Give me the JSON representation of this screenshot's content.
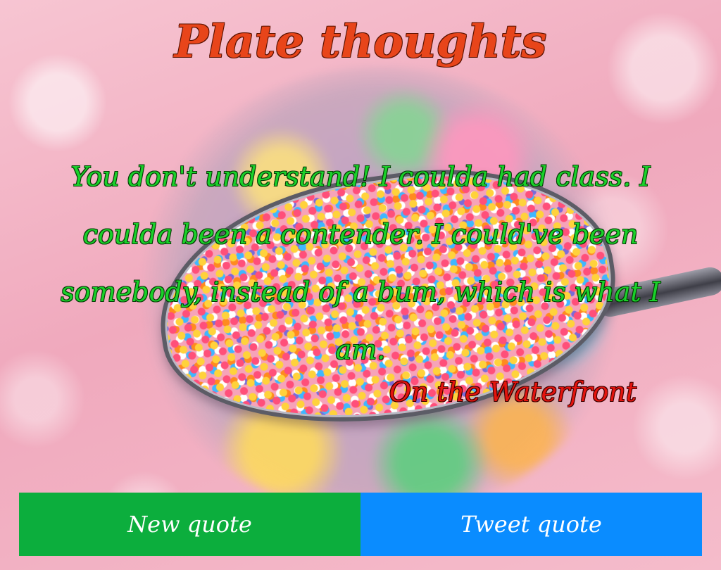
{
  "app": {
    "title": "Plate thoughts"
  },
  "quote": {
    "text": "You don't understand! I coulda had class. I coulda been a contender. I could've been somebody, instead of a bum, which is what I am.",
    "author": "On the Waterfront"
  },
  "buttons": {
    "new_quote_label": "New quote",
    "tweet_quote_label": "Tweet quote"
  },
  "colors": {
    "title": "#e8451a",
    "quote_text": "#1ad12a",
    "quote_author": "#e3140e",
    "new_quote_button": "#0cae3d",
    "tweet_quote_button": "#0a8cff"
  },
  "background": {
    "image_subject": "sprinkles-on-spoon-image"
  }
}
